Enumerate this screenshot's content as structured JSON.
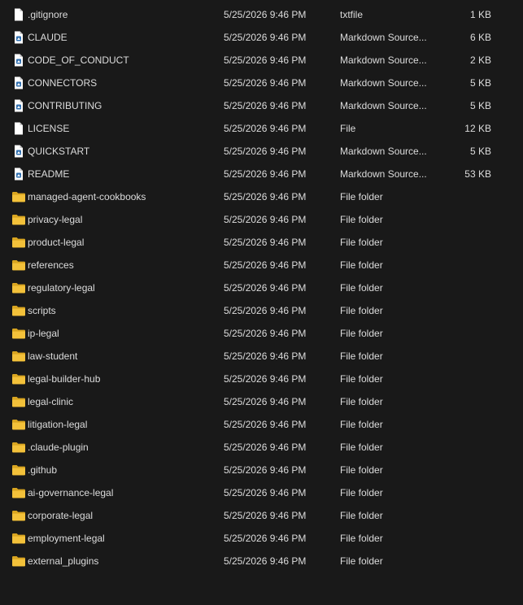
{
  "files": [
    {
      "name": ".gitignore",
      "date": "5/25/2026 9:46 PM",
      "type": "txtfile",
      "size": "1 KB",
      "icon": "file-icon"
    },
    {
      "name": "CLAUDE",
      "date": "5/25/2026 9:46 PM",
      "type": "Markdown Source...",
      "size": "6 KB",
      "icon": "markdown-file-icon"
    },
    {
      "name": "CODE_OF_CONDUCT",
      "date": "5/25/2026 9:46 PM",
      "type": "Markdown Source...",
      "size": "2 KB",
      "icon": "markdown-file-icon"
    },
    {
      "name": "CONNECTORS",
      "date": "5/25/2026 9:46 PM",
      "type": "Markdown Source...",
      "size": "5 KB",
      "icon": "markdown-file-icon"
    },
    {
      "name": "CONTRIBUTING",
      "date": "5/25/2026 9:46 PM",
      "type": "Markdown Source...",
      "size": "5 KB",
      "icon": "markdown-file-icon"
    },
    {
      "name": "LICENSE",
      "date": "5/25/2026 9:46 PM",
      "type": "File",
      "size": "12 KB",
      "icon": "file-icon"
    },
    {
      "name": "QUICKSTART",
      "date": "5/25/2026 9:46 PM",
      "type": "Markdown Source...",
      "size": "5 KB",
      "icon": "markdown-file-icon"
    },
    {
      "name": "README",
      "date": "5/25/2026 9:46 PM",
      "type": "Markdown Source...",
      "size": "53 KB",
      "icon": "markdown-file-icon"
    },
    {
      "name": "managed-agent-cookbooks",
      "date": "5/25/2026 9:46 PM",
      "type": "File folder",
      "size": "",
      "icon": "folder-icon"
    },
    {
      "name": "privacy-legal",
      "date": "5/25/2026 9:46 PM",
      "type": "File folder",
      "size": "",
      "icon": "folder-icon"
    },
    {
      "name": "product-legal",
      "date": "5/25/2026 9:46 PM",
      "type": "File folder",
      "size": "",
      "icon": "folder-icon"
    },
    {
      "name": "references",
      "date": "5/25/2026 9:46 PM",
      "type": "File folder",
      "size": "",
      "icon": "folder-icon"
    },
    {
      "name": "regulatory-legal",
      "date": "5/25/2026 9:46 PM",
      "type": "File folder",
      "size": "",
      "icon": "folder-icon"
    },
    {
      "name": "scripts",
      "date": "5/25/2026 9:46 PM",
      "type": "File folder",
      "size": "",
      "icon": "folder-icon"
    },
    {
      "name": "ip-legal",
      "date": "5/25/2026 9:46 PM",
      "type": "File folder",
      "size": "",
      "icon": "folder-icon"
    },
    {
      "name": "law-student",
      "date": "5/25/2026 9:46 PM",
      "type": "File folder",
      "size": "",
      "icon": "folder-icon"
    },
    {
      "name": "legal-builder-hub",
      "date": "5/25/2026 9:46 PM",
      "type": "File folder",
      "size": "",
      "icon": "folder-icon"
    },
    {
      "name": "legal-clinic",
      "date": "5/25/2026 9:46 PM",
      "type": "File folder",
      "size": "",
      "icon": "folder-icon"
    },
    {
      "name": "litigation-legal",
      "date": "5/25/2026 9:46 PM",
      "type": "File folder",
      "size": "",
      "icon": "folder-icon"
    },
    {
      "name": ".claude-plugin",
      "date": "5/25/2026 9:46 PM",
      "type": "File folder",
      "size": "",
      "icon": "folder-icon"
    },
    {
      "name": ".github",
      "date": "5/25/2026 9:46 PM",
      "type": "File folder",
      "size": "",
      "icon": "folder-icon"
    },
    {
      "name": "ai-governance-legal",
      "date": "5/25/2026 9:46 PM",
      "type": "File folder",
      "size": "",
      "icon": "folder-icon"
    },
    {
      "name": "corporate-legal",
      "date": "5/25/2026 9:46 PM",
      "type": "File folder",
      "size": "",
      "icon": "folder-icon"
    },
    {
      "name": "employment-legal",
      "date": "5/25/2026 9:46 PM",
      "type": "File folder",
      "size": "",
      "icon": "folder-icon"
    },
    {
      "name": "external_plugins",
      "date": "5/25/2026 9:46 PM",
      "type": "File folder",
      "size": "",
      "icon": "folder-icon"
    }
  ],
  "colors": {
    "background": "#191919",
    "text": "#dcdcdc",
    "folder": "#f3c13a",
    "file": "#ffffff"
  }
}
